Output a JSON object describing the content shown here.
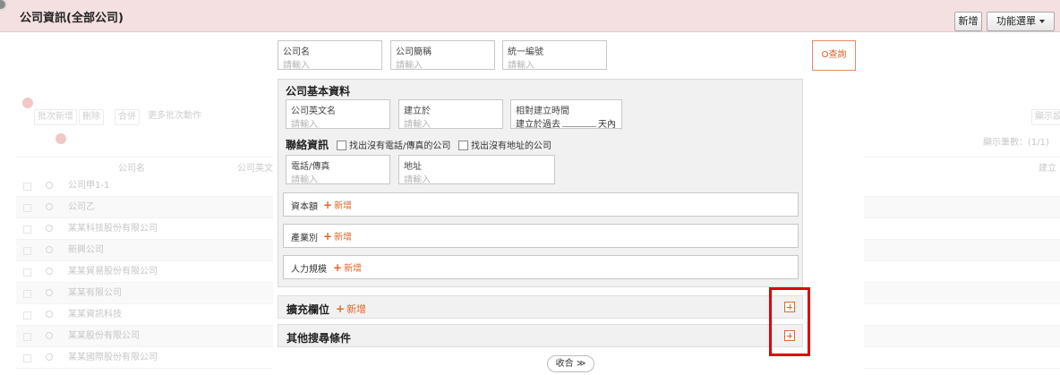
{
  "header": {
    "title": "公司資訊(全部公司)",
    "new_button": "新增",
    "menu_button": "功能選單"
  },
  "background": {
    "toolbar": [
      "批次新增",
      "刪除",
      "合併",
      "更多批次動作"
    ],
    "right_button": "顯示設",
    "count_text": "顯示筆數：(1/1)",
    "col_headers": [
      "公司名",
      "公司英文名",
      "建立"
    ],
    "rows": [
      "公司甲1-1",
      "公司乙",
      "某某科技股份有限公司",
      "新興公司",
      "某某貿易股份有限公司",
      "某某有限公司",
      "某某資訊科技",
      "某某股份有限公司",
      "某某國際股份有限公司"
    ]
  },
  "search": {
    "top_fields": [
      {
        "label": "公司名",
        "placeholder": "請輸入"
      },
      {
        "label": "公司簡稱",
        "placeholder": "請輸入"
      },
      {
        "label": "統一編號",
        "placeholder": "請輸入"
      }
    ],
    "search_button": "查詢",
    "basic": {
      "title": "公司基本資料",
      "english_name": {
        "label": "公司英文名",
        "placeholder": "請輸入"
      },
      "established": {
        "label": "建立於",
        "placeholder": "請輸入"
      },
      "relative_time": {
        "label": "相對建立時間",
        "prefix": "建立於過去",
        "suffix": "天內"
      },
      "contact_title": "聯絡資訊",
      "no_phone_check": "找出沒有電話/傳真的公司",
      "no_address_check": "找出沒有地址的公司",
      "phone": {
        "label": "電話/傳真",
        "placeholder": "請輸入"
      },
      "address": {
        "label": "地址",
        "placeholder": "請輸入"
      },
      "capital": {
        "label": "資本額",
        "add": "新增"
      },
      "industry": {
        "label": "產業別",
        "add": "新增"
      },
      "headcount": {
        "label": "人力規模",
        "add": "新增"
      }
    },
    "extended": {
      "title": "擴充欄位",
      "add": "新增"
    },
    "other": {
      "title": "其他搜尋條件"
    },
    "collapse": "收合 ≫"
  },
  "colors": {
    "accent": "#e2672a",
    "header_bg": "#f4e0e0",
    "highlight": "#e00000"
  }
}
